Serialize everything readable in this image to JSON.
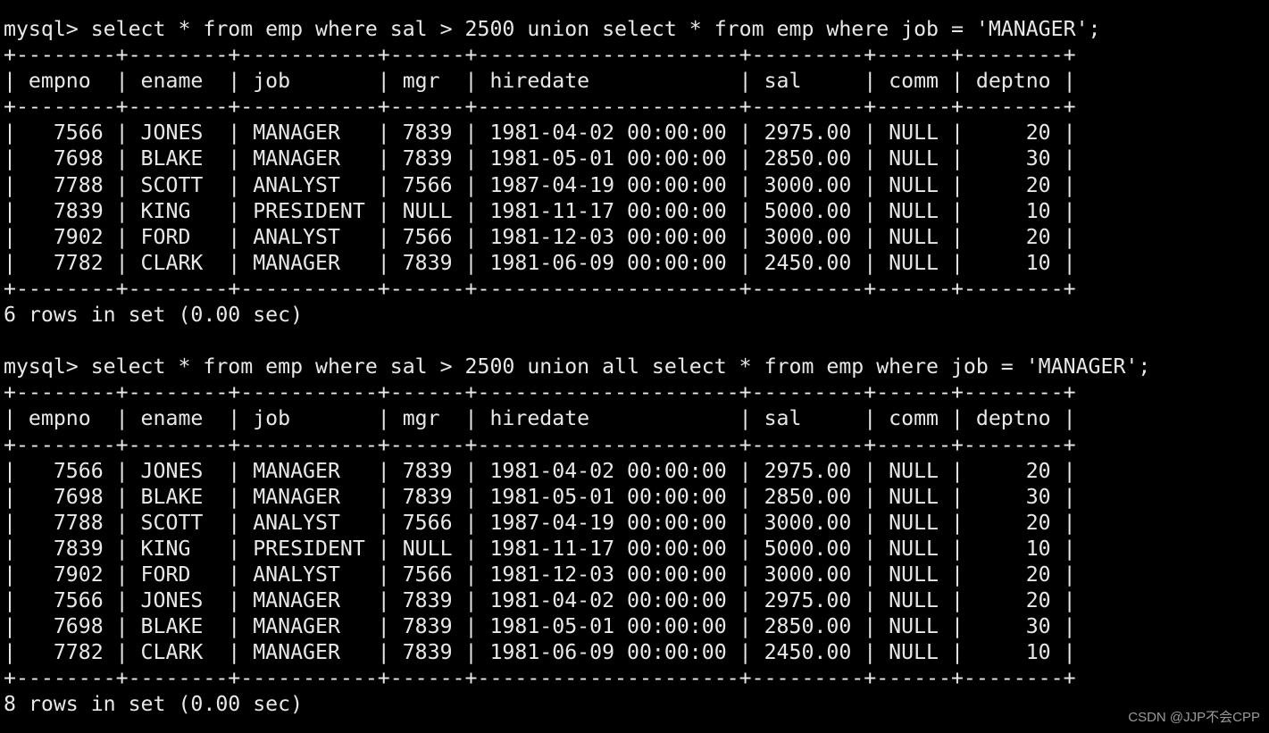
{
  "terminal": {
    "background_color": "#000000",
    "text_color": "#e8e8e8",
    "watermark": "CSDN @JJP不会CPP",
    "prompt": "mysql>",
    "blocks": [
      {
        "id": "query-1",
        "command": "mysql> select * from emp where sal > 2500 union select * from emp where job = 'MANAGER';",
        "sql": "select * from emp where sal > 2500 union select * from emp where job = 'MANAGER';",
        "separator": "+--------+--------+-----------+------+---------------------+---------+------+--------+",
        "header": "| empno  | ename  | job       | mgr  | hiredate            | sal     | comm | deptno |",
        "columns": [
          "empno",
          "ename",
          "job",
          "mgr",
          "hiredate",
          "sal",
          "comm",
          "deptno"
        ],
        "rows": [
          [
            "7566",
            "JONES",
            "MANAGER",
            "7839",
            "1981-04-02 00:00:00",
            "2975.00",
            "NULL",
            "20"
          ],
          [
            "7698",
            "BLAKE",
            "MANAGER",
            "7839",
            "1981-05-01 00:00:00",
            "2850.00",
            "NULL",
            "30"
          ],
          [
            "7788",
            "SCOTT",
            "ANALYST",
            "7566",
            "1987-04-19 00:00:00",
            "3000.00",
            "NULL",
            "20"
          ],
          [
            "7839",
            "KING",
            "PRESIDENT",
            "NULL",
            "1981-11-17 00:00:00",
            "5000.00",
            "NULL",
            "10"
          ],
          [
            "7902",
            "FORD",
            "ANALYST",
            "7566",
            "1981-12-03 00:00:00",
            "3000.00",
            "NULL",
            "20"
          ],
          [
            "7782",
            "CLARK",
            "MANAGER",
            "7839",
            "1981-06-09 00:00:00",
            "2450.00",
            "NULL",
            "10"
          ]
        ],
        "row_lines": [
          "|   7566 | JONES  | MANAGER   | 7839 | 1981-04-02 00:00:00 | 2975.00 | NULL |     20 |",
          "|   7698 | BLAKE  | MANAGER   | 7839 | 1981-05-01 00:00:00 | 2850.00 | NULL |     30 |",
          "|   7788 | SCOTT  | ANALYST   | 7566 | 1987-04-19 00:00:00 | 3000.00 | NULL |     20 |",
          "|   7839 | KING   | PRESIDENT | NULL | 1981-11-17 00:00:00 | 5000.00 | NULL |     10 |",
          "|   7902 | FORD   | ANALYST   | 7566 | 1981-12-03 00:00:00 | 3000.00 | NULL |     20 |",
          "|   7782 | CLARK  | MANAGER   | 7839 | 1981-06-09 00:00:00 | 2450.00 | NULL |     10 |"
        ],
        "row_count": 6,
        "status": "6 rows in set (0.00 sec)"
      },
      {
        "id": "query-2",
        "command": "mysql> select * from emp where sal > 2500 union all select * from emp where job = 'MANAGER';",
        "sql": "select * from emp where sal > 2500 union all select * from emp where job = 'MANAGER';",
        "separator": "+--------+--------+-----------+------+---------------------+---------+------+--------+",
        "header": "| empno  | ename  | job       | mgr  | hiredate            | sal     | comm | deptno |",
        "columns": [
          "empno",
          "ename",
          "job",
          "mgr",
          "hiredate",
          "sal",
          "comm",
          "deptno"
        ],
        "rows": [
          [
            "7566",
            "JONES",
            "MANAGER",
            "7839",
            "1981-04-02 00:00:00",
            "2975.00",
            "NULL",
            "20"
          ],
          [
            "7698",
            "BLAKE",
            "MANAGER",
            "7839",
            "1981-05-01 00:00:00",
            "2850.00",
            "NULL",
            "30"
          ],
          [
            "7788",
            "SCOTT",
            "ANALYST",
            "7566",
            "1987-04-19 00:00:00",
            "3000.00",
            "NULL",
            "20"
          ],
          [
            "7839",
            "KING",
            "PRESIDENT",
            "NULL",
            "1981-11-17 00:00:00",
            "5000.00",
            "NULL",
            "10"
          ],
          [
            "7902",
            "FORD",
            "ANALYST",
            "7566",
            "1981-12-03 00:00:00",
            "3000.00",
            "NULL",
            "20"
          ],
          [
            "7566",
            "JONES",
            "MANAGER",
            "7839",
            "1981-04-02 00:00:00",
            "2975.00",
            "NULL",
            "20"
          ],
          [
            "7698",
            "BLAKE",
            "MANAGER",
            "7839",
            "1981-05-01 00:00:00",
            "2850.00",
            "NULL",
            "30"
          ],
          [
            "7782",
            "CLARK",
            "MANAGER",
            "7839",
            "1981-06-09 00:00:00",
            "2450.00",
            "NULL",
            "10"
          ]
        ],
        "row_lines": [
          "|   7566 | JONES  | MANAGER   | 7839 | 1981-04-02 00:00:00 | 2975.00 | NULL |     20 |",
          "|   7698 | BLAKE  | MANAGER   | 7839 | 1981-05-01 00:00:00 | 2850.00 | NULL |     30 |",
          "|   7788 | SCOTT  | ANALYST   | 7566 | 1987-04-19 00:00:00 | 3000.00 | NULL |     20 |",
          "|   7839 | KING   | PRESIDENT | NULL | 1981-11-17 00:00:00 | 5000.00 | NULL |     10 |",
          "|   7902 | FORD   | ANALYST   | 7566 | 1981-12-03 00:00:00 | 3000.00 | NULL |     20 |",
          "|   7566 | JONES  | MANAGER   | 7839 | 1981-04-02 00:00:00 | 2975.00 | NULL |     20 |",
          "|   7698 | BLAKE  | MANAGER   | 7839 | 1981-05-01 00:00:00 | 2850.00 | NULL |     30 |",
          "|   7782 | CLARK  | MANAGER   | 7839 | 1981-06-09 00:00:00 | 2450.00 | NULL |     10 |"
        ],
        "row_count": 8,
        "status": "8 rows in set (0.00 sec)"
      }
    ]
  }
}
